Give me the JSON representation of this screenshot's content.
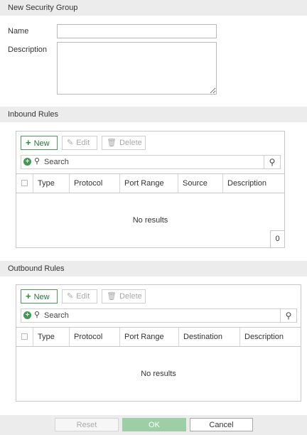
{
  "dialog": {
    "title": "New Security Group",
    "name_label": "Name",
    "name_value": "",
    "description_label": "Description",
    "description_value": ""
  },
  "inbound": {
    "heading": "Inbound Rules",
    "toolbar": {
      "new_label": "New",
      "edit_label": "Edit",
      "delete_label": "Delete"
    },
    "search": {
      "placeholder": "Search"
    },
    "columns": [
      "Type",
      "Protocol",
      "Port Range",
      "Source",
      "Description"
    ],
    "empty_text": "No results",
    "count": "0"
  },
  "outbound": {
    "heading": "Outbound Rules",
    "toolbar": {
      "new_label": "New",
      "edit_label": "Edit",
      "delete_label": "Delete"
    },
    "search": {
      "placeholder": "Search"
    },
    "columns": [
      "Type",
      "Protocol",
      "Port Range",
      "Destination",
      "Description"
    ],
    "empty_text": "No results"
  },
  "footer": {
    "reset_label": "Reset",
    "ok_label": "OK",
    "cancel_label": "Cancel"
  },
  "colors": {
    "accent_green": "#2e8b3e",
    "ok_button": "#9ccfa5",
    "header_bg": "#ececec"
  }
}
